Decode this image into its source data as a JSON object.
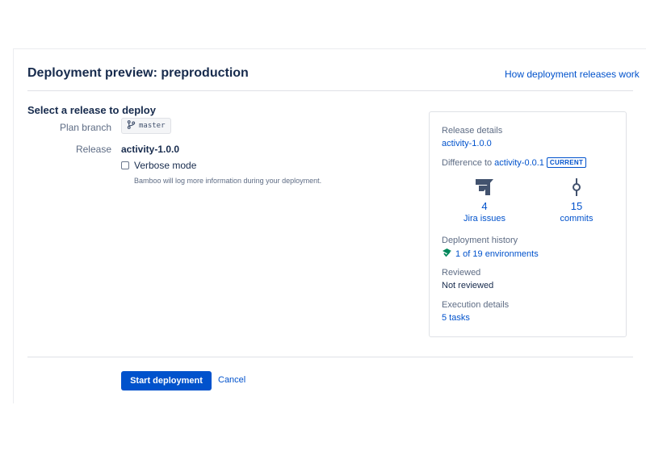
{
  "dialog": {
    "title": "Deployment preview: preproduction",
    "help_link": "How deployment releases work"
  },
  "release_form": {
    "heading": "Select a release to deploy",
    "plan_branch_label": "Plan branch",
    "plan_branch_value": "master",
    "release_label": "Release",
    "release_value": "activity-1.0.0",
    "verbose_label": "Verbose mode",
    "verbose_checked": false,
    "verbose_help": "Bamboo will log more information during your deployment."
  },
  "details": {
    "release_details_label": "Release details",
    "release_details_value": "activity-1.0.0",
    "difference_prefix": "Difference to",
    "difference_version": "activity-0.0.1",
    "difference_badge": "CURRENT",
    "jira_count": "4",
    "jira_label": "Jira issues",
    "commits_count": "15",
    "commits_label": "commits",
    "history_label": "Deployment history",
    "history_value": "1 of 19 environments",
    "reviewed_label": "Reviewed",
    "reviewed_value": "Not reviewed",
    "execution_label": "Execution details",
    "execution_value": "5 tasks"
  },
  "actions": {
    "start_label": "Start deployment",
    "cancel_label": "Cancel"
  },
  "colors": {
    "primary": "#0052cc",
    "text": "#172b4d",
    "subtle": "#5e6c84",
    "success": "#00875a",
    "jira_icon": "#42526e"
  },
  "icons": {
    "branch": "branch-icon",
    "jira": "jira-icon",
    "commit": "commit-icon",
    "history": "deployment-success-icon"
  }
}
